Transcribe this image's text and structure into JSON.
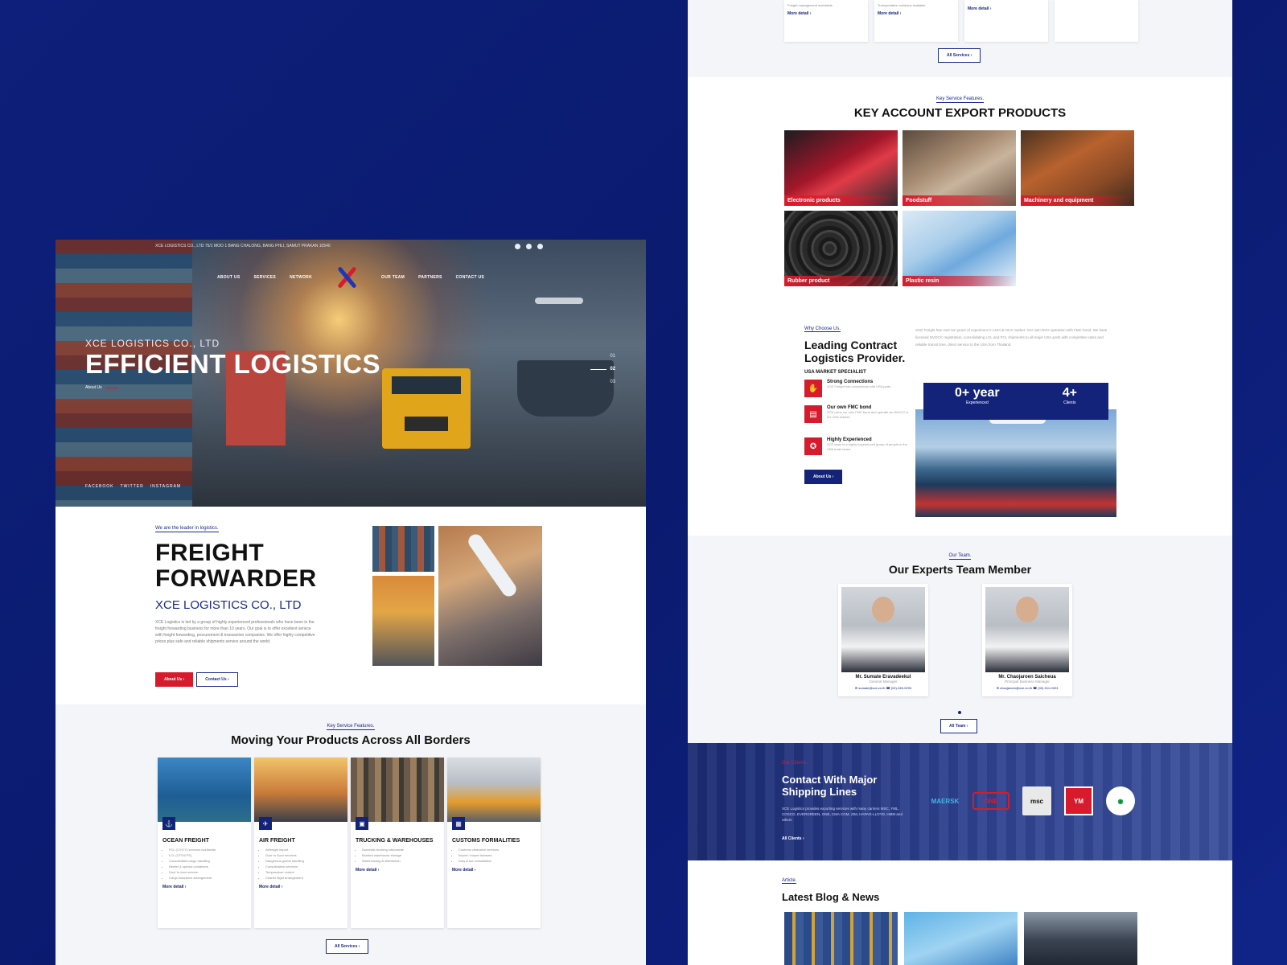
{
  "hero": {
    "topbar_address": "XCE LOGISTICS CO., LTD 75/1 MOO 1 BANG CHALONG, BANG PHLI, SAMUT PRAKAN 10540",
    "nav": [
      "ABOUT US",
      "SERVICES",
      "NETWORK",
      "OUR TEAM",
      "PARTNERS",
      "CONTACT US"
    ],
    "company": "XCE LOGISTICS CO., LTD",
    "headline": "EFFICIENT LOGISTICS",
    "about_link": "About Us",
    "slides": [
      "01",
      "02",
      "03"
    ],
    "social": [
      "FACEBOOK",
      "TWITTER",
      "INSTAGRAM"
    ]
  },
  "freight": {
    "eyebrow": "We are the leader in logistics.",
    "title_line1": "FREIGHT",
    "title_line2": "FORWARDER",
    "company": "XCE LOGISTICS CO., LTD",
    "description": "XCE Logistics is led by a group of highly experienced professionals who have been in the freight forwarding business for more than 10 years. Our goal is to offer excellent service with freight forwarding, procurement & transaction companies. We offer highly competitive prices plus safe and reliable shipments service around the world.",
    "about_btn": "About Us ›",
    "contact_btn": "Contact Us ›"
  },
  "services": {
    "eyebrow": "Key Service Features.",
    "title": "Moving Your Products Across All Borders",
    "cards": [
      {
        "title": "OCEAN FREIGHT",
        "items": [
          "FCL (CY/CY) services worldwide",
          "LCL (CFS/CFS)",
          "Consolidated cargo handling",
          "Reefer & special containers",
          "Door to door service",
          "Cargo insurance arrangement"
        ],
        "more": "More detail ›"
      },
      {
        "title": "AIR FREIGHT",
        "items": [
          "Airfreight import",
          "Door to Door services",
          "Dangerous goods handling",
          "Consolidation services",
          "Temperature control",
          "Charter flight arrangement"
        ],
        "more": "More detail ›"
      },
      {
        "title": "TRUCKING & WAREHOUSES",
        "items": [
          "Domestic trucking nationwide",
          "Bonded warehouse storage",
          "Warehousing & distribution"
        ],
        "more": "More detail ›"
      },
      {
        "title": "CUSTOMS FORMALITIES",
        "items": [
          "Customs clearance services",
          "Import / export licenses",
          "Duty & tax consultation"
        ],
        "more": "More detail ›"
      }
    ],
    "all_btn": "All Services ›"
  },
  "right_top": {
    "cards": [
      {
        "text": "Freight management worldwide",
        "more": "More detail ›"
      },
      {
        "text": "Transportation solutions available",
        "more": "More detail ›"
      },
      {
        "text": "",
        "more": "More detail ›"
      },
      {
        "text": "",
        "more": ""
      }
    ],
    "all_btn": "All Services ›"
  },
  "export": {
    "eyebrow": "Key Service Features.",
    "title": "KEY ACCOUNT EXPORT PRODUCTS",
    "products": [
      "Electronic products",
      "Foodstuff",
      "Machinery and equipment",
      "Rubber product",
      "Plastic resin"
    ]
  },
  "why": {
    "eyebrow": "Why Choose Us.",
    "title": "Leading Contract Logistics Provider.",
    "subtitle": "USA MARKET SPECIALIST",
    "paragraph": "XCE Freight has over ten years of experience in USA & NCX market. Our own NVO operation with FMC bond. We have licensed NVOCC registration, consolidating LCL and FCL shipments to all major USA ports with competitive rates and reliable transit time, direct service to the USA from Thailand.",
    "features": [
      {
        "title": "Strong Connections",
        "text": "XCE Freight has connections with USA ports."
      },
      {
        "title": "Our own FMC bond",
        "text": "XCE owns our own FMC bond and operate as NVOCC in the USA market."
      },
      {
        "title": "Highly Experienced",
        "text": "XCE team is a highly experienced group of people in the USA trade lanes."
      }
    ],
    "about_btn": "About Us ›",
    "stats": [
      {
        "n": "0+ year",
        "l": "Experienced"
      },
      {
        "n": "4+",
        "l": "Clients"
      }
    ]
  },
  "team": {
    "eyebrow": "Our Team.",
    "title": "Our Experts Team Member",
    "members": [
      {
        "name": "Mr. Sumate Eravadeekul",
        "role": "General Manager",
        "email": "sumate@xce.co.th",
        "phone": "(02)-045-0290"
      },
      {
        "name": "Mr. Chaojaroen Saicheua",
        "role": "Principal Business Manager",
        "email": "chaojaroen@xce.co.th",
        "phone": "(02)-011-0323"
      }
    ],
    "all_btn": "All Team ›"
  },
  "contact": {
    "eyebrow": "Our Clients.",
    "title": "Contact With Major Shipping Lines",
    "desc": "XCE Logistics provides exporting services with many carriers MSC, YML, COSCO, EVERGREEN, ONE, CMA CGM, ZIM, HAPAG-LLOYD, HMM and others",
    "link": "All Clients ›",
    "carriers": [
      "MAERSK",
      "ONE",
      "msc",
      "YM",
      "EVERGREEN"
    ]
  },
  "blog": {
    "eyebrow": "Article.",
    "title": "Latest Blog & News"
  }
}
